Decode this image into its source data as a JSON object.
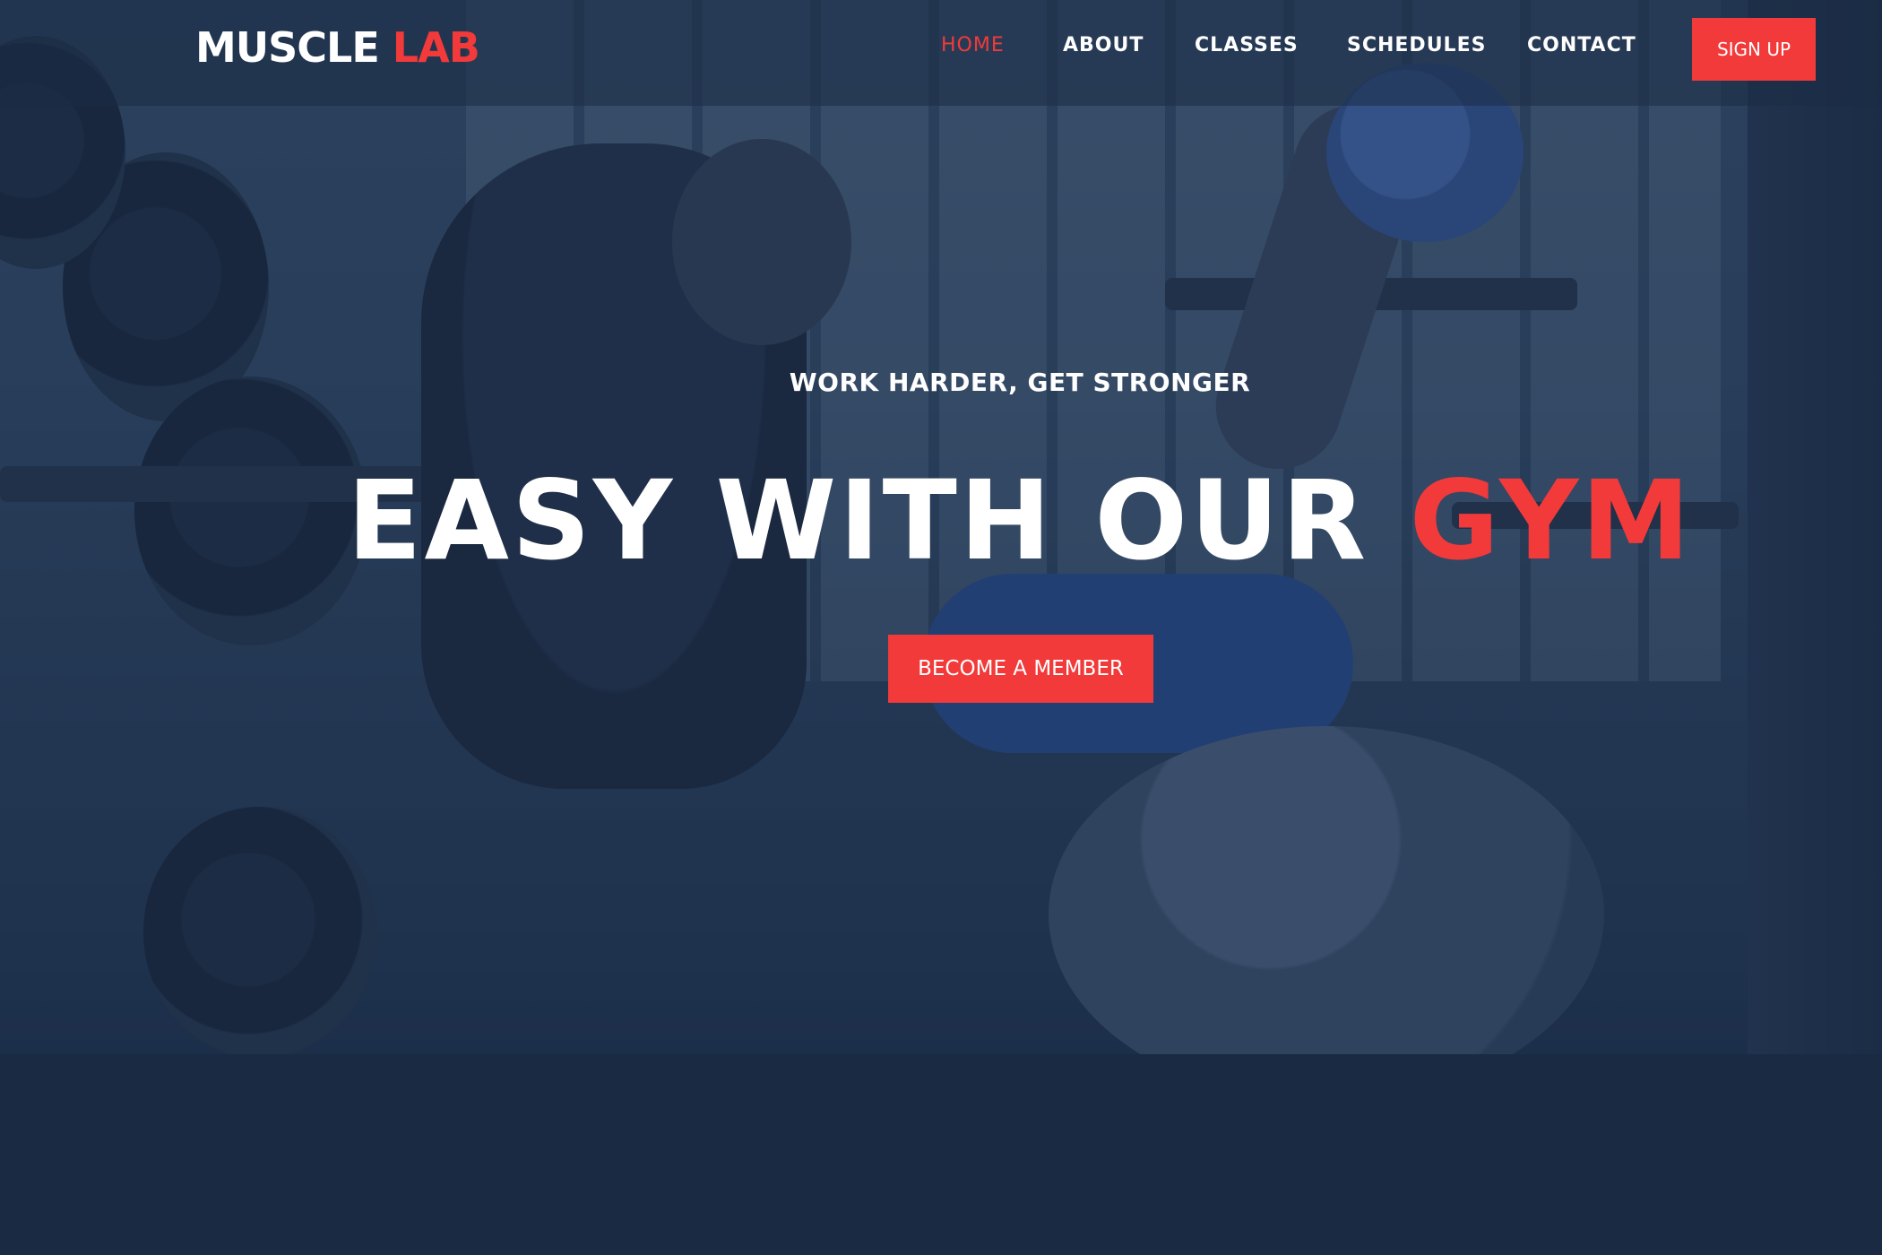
{
  "brand": {
    "logo_primary": "MUSCLE",
    "logo_accent": "LAB",
    "accent_color": "#f23a3a",
    "background_color": "#1a2a43"
  },
  "nav": {
    "items": [
      {
        "label": "HOME",
        "active": true
      },
      {
        "label": "ABOUT",
        "active": false
      },
      {
        "label": "CLASSES",
        "active": false
      },
      {
        "label": "SCHEDULES",
        "active": false
      },
      {
        "label": "CONTACT",
        "active": false
      }
    ],
    "signup_label": "SIGN UP"
  },
  "hero": {
    "tagline": "WORK HARDER, GET STRONGER",
    "headline_main": "EASY WITH OUR",
    "headline_accent": "GYM",
    "cta_label": "BECOME A MEMBER"
  }
}
